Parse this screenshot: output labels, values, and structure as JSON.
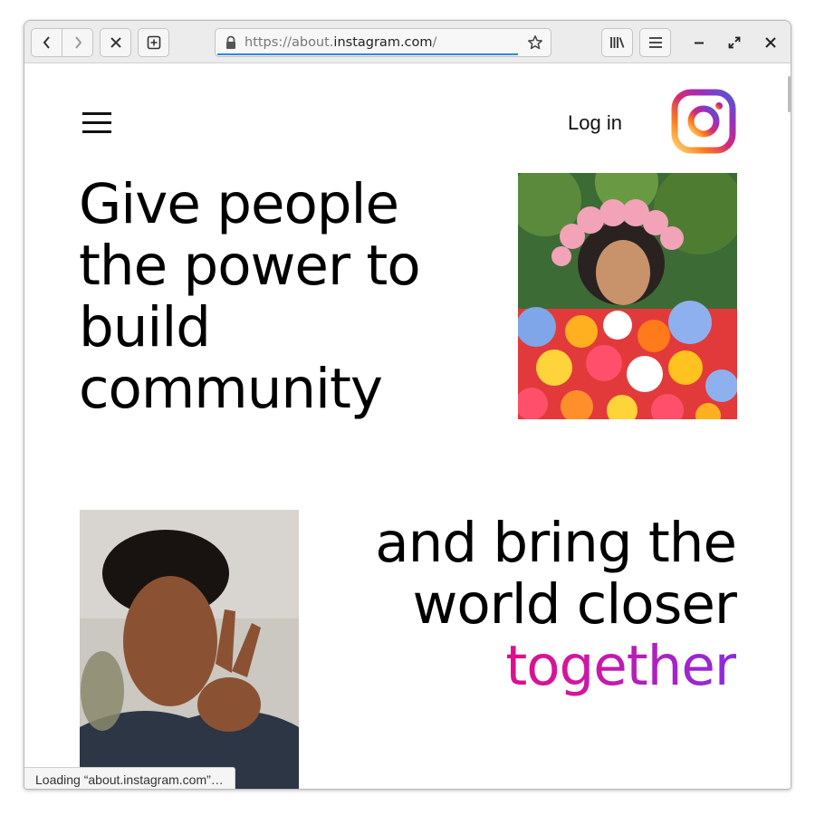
{
  "browser": {
    "url_prefix": "https://about.",
    "url_domain": "instagram.com",
    "url_suffix": "/",
    "status_text": "Loading “about.instagram.com”…"
  },
  "page": {
    "nav": {
      "login_label": "Log in"
    },
    "hero": {
      "headline_lines": [
        "Give people",
        "the power to",
        "build",
        "community"
      ]
    },
    "second": {
      "headline_lines": [
        "and bring the",
        "world closer"
      ],
      "highlight_word": "together"
    }
  },
  "icons": {
    "back": "chevron-left-icon",
    "forward": "chevron-right-icon",
    "stop": "close-icon",
    "new_tab": "plus-square-icon",
    "lock": "lock-icon",
    "bookmark": "star-icon",
    "library": "library-icon",
    "menu": "menu-icon",
    "minimize": "minimize-icon",
    "maximize": "maximize-icon",
    "close": "close-icon",
    "brand": "instagram-logo"
  },
  "colors": {
    "accent_gradient": [
      "#e6005c",
      "#d6159c",
      "#8a2be2"
    ],
    "url_focus": "#3584e4",
    "logo_gradient": [
      "#feda75",
      "#fa7e1e",
      "#d62976",
      "#962fbf",
      "#4f5bd5"
    ]
  }
}
